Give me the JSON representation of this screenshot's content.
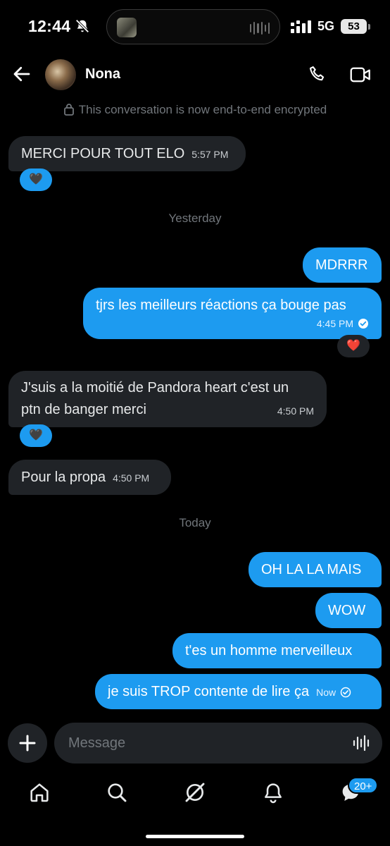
{
  "status": {
    "time": "12:44",
    "network": "5G",
    "battery": "53"
  },
  "header": {
    "contact_name": "Nona"
  },
  "encryption_notice": "This conversation is now end-to-end encrypted",
  "messages": [
    {
      "text": "MERCI POUR TOUT ELO",
      "time": "5:57 PM",
      "reaction": "🖤"
    },
    {
      "day": "Yesterday"
    },
    {
      "text": "MDRRR"
    },
    {
      "text": "tjrs les meilleurs réactions ça bouge pas",
      "time": "4:45 PM",
      "reaction": "❤️"
    },
    {
      "text_line1": "J'suis a la moitié de Pandora heart c'est un",
      "text_line2": "ptn de banger merci",
      "time": "4:50 PM",
      "reaction": "🖤"
    },
    {
      "text": "Pour la propa",
      "time": "4:50 PM"
    },
    {
      "day": "Today"
    },
    {
      "text": "OH LA LA MAIS"
    },
    {
      "text": "WOW"
    },
    {
      "text": "t'es un homme merveilleux"
    },
    {
      "text": "je suis TROP contente de lire ça",
      "time": "Now"
    }
  ],
  "composer": {
    "placeholder": "Message"
  },
  "nav": {
    "messages_badge": "20+"
  },
  "colors": {
    "accent": "#1d9bf0",
    "incoming_bubble": "#202327",
    "background": "#000000"
  }
}
